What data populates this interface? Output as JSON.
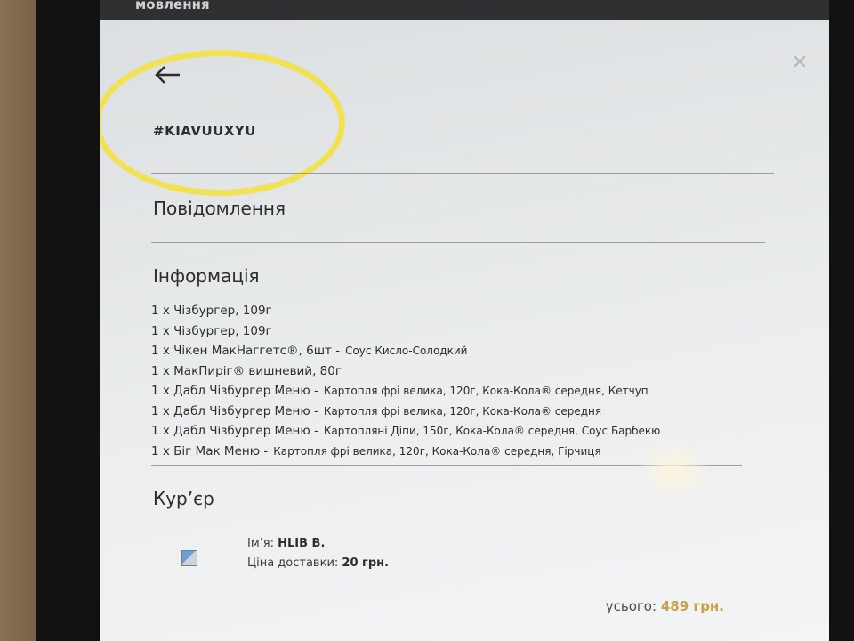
{
  "header": {
    "partial_title": "мовлення",
    "order_id": "#KIAVUUXYU"
  },
  "sections": {
    "message_title": "Повідомлення",
    "info_title": "Інформація",
    "courier_title": "Кур’єр"
  },
  "order_items": [
    {
      "line": "1 x Чізбургер, 109г",
      "extras": ""
    },
    {
      "line": "1 x Чізбургер, 109г",
      "extras": ""
    },
    {
      "line": "1 x Чікен МакНаггетс®, 6шт -",
      "extras": "Соус Кисло-Солодкий"
    },
    {
      "line": "1 x МакПиріг® вишневий, 80г",
      "extras": ""
    },
    {
      "line": "1 x Дабл Чізбургер Меню -",
      "extras": "Картопля фрі велика, 120г,  Кока-Кола® середня,  Кетчуп"
    },
    {
      "line": "1 x Дабл Чізбургер Меню -",
      "extras": "Картопля фрі велика, 120г,  Кока-Кола® середня"
    },
    {
      "line": "1 x Дабл Чізбургер Меню -",
      "extras": "Картопляні Діпи, 150г,  Кока-Кола® середня,  Соус Барбекю"
    },
    {
      "line": "1 x Біг Мак Меню -",
      "extras": "Картопля фрі велика, 120г,  Кока-Кола® середня,  Гірчиця"
    }
  ],
  "courier": {
    "name_label": "Ім’я:",
    "name_value": "HLIB B.",
    "delivery_label": "Ціна доставки:",
    "delivery_value": "20 грн."
  },
  "total": {
    "label": "усього:",
    "value": "489 грн."
  },
  "colors": {
    "highlight": "#f5e13c",
    "total_value": "#c8a14a"
  },
  "icons": {
    "back": "arrow-left-icon",
    "close": "close-icon",
    "courier_photo": "broken-image-icon"
  }
}
